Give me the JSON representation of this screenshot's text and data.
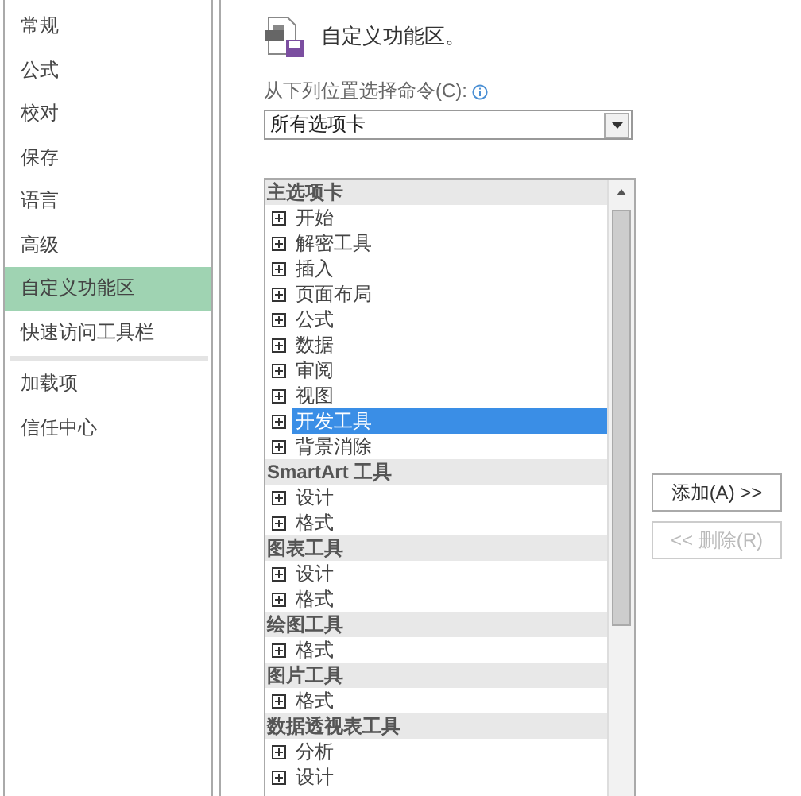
{
  "sidebar": {
    "groups": [
      {
        "items": [
          {
            "label": "常规",
            "selected": false
          },
          {
            "label": "公式",
            "selected": false
          },
          {
            "label": "校对",
            "selected": false
          },
          {
            "label": "保存",
            "selected": false
          },
          {
            "label": "语言",
            "selected": false
          },
          {
            "label": "高级",
            "selected": false
          },
          {
            "label": "自定义功能区",
            "selected": true
          },
          {
            "label": "快速访问工具栏",
            "selected": false
          }
        ]
      },
      {
        "items": [
          {
            "label": "加载项",
            "selected": false
          },
          {
            "label": "信任中心",
            "selected": false
          }
        ]
      }
    ]
  },
  "main": {
    "title": "自定义功能区。",
    "choose_label": "从下列位置选择命令(C):",
    "dropdown": {
      "value": "所有选项卡"
    },
    "list": {
      "groups": [
        {
          "header": "主选项卡",
          "items": [
            {
              "label": "开始",
              "selected": false
            },
            {
              "label": "解密工具",
              "selected": false
            },
            {
              "label": "插入",
              "selected": false
            },
            {
              "label": "页面布局",
              "selected": false
            },
            {
              "label": "公式",
              "selected": false
            },
            {
              "label": "数据",
              "selected": false
            },
            {
              "label": "审阅",
              "selected": false
            },
            {
              "label": "视图",
              "selected": false
            },
            {
              "label": "开发工具",
              "selected": true
            },
            {
              "label": "背景消除",
              "selected": false
            }
          ]
        },
        {
          "header": "SmartArt 工具",
          "items": [
            {
              "label": "设计",
              "selected": false
            },
            {
              "label": "格式",
              "selected": false
            }
          ]
        },
        {
          "header": "图表工具",
          "items": [
            {
              "label": "设计",
              "selected": false
            },
            {
              "label": "格式",
              "selected": false
            }
          ]
        },
        {
          "header": "绘图工具",
          "items": [
            {
              "label": "格式",
              "selected": false
            }
          ]
        },
        {
          "header": "图片工具",
          "items": [
            {
              "label": "格式",
              "selected": false
            }
          ]
        },
        {
          "header": "数据透视表工具",
          "items": [
            {
              "label": "分析",
              "selected": false
            },
            {
              "label": "设计",
              "selected": false
            }
          ]
        }
      ]
    },
    "buttons": [
      {
        "label": "添加(A) >>",
        "disabled": false
      },
      {
        "label": "<< 删除(R)",
        "disabled": true
      }
    ]
  }
}
